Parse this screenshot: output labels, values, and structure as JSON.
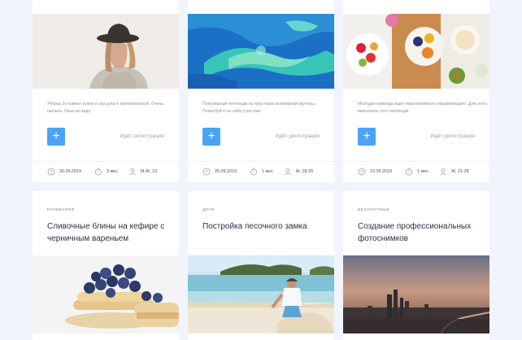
{
  "cards": [
    {
      "description": "Уборка 2х комнат кухни и сан узла в трехкомнатной. Очень пыльно. Окна не надо.",
      "register": "Идёт регистрация",
      "date": "30.09.2019",
      "duration": "3 мес",
      "audience": "М-Ж, 23"
    },
    {
      "description": "Популярный челлендж на просторах всемирной паутины. Попробуй и ты себя у регулы!",
      "register": "Идёт регистрация",
      "date": "25.09.2019",
      "duration": "1 мес",
      "audience": "М, 18-25"
    },
    {
      "description": "Молодая команда ищет перспективного управляющего. Для этого выполнить этот челлендж",
      "register": "Идёт регистрация",
      "date": "23.09.2019",
      "duration": "1 мес",
      "audience": "Ж, 21-28"
    },
    {
      "tag": "кулинария",
      "title": "Сливочные блины на кефире с черничным вареньем"
    },
    {
      "tag": "дети",
      "title": "Постройка песочного замка"
    },
    {
      "tag": "бесплатные",
      "title": "Создание профессиональных фотоснимков"
    }
  ],
  "icons": {
    "calendar": "calendar-icon",
    "timer": "stopwatch-icon",
    "person": "person-icon",
    "add": "plus-icon"
  },
  "colors": {
    "accent": "#4aa3f5",
    "background": "#f1f4fb",
    "card": "#ffffff"
  }
}
